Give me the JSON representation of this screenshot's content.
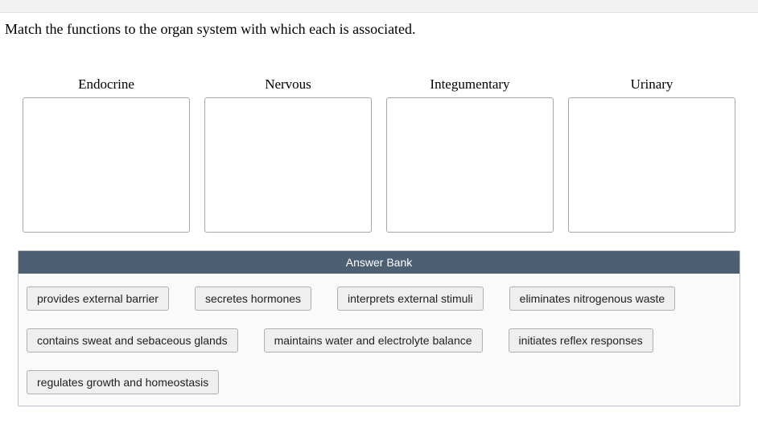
{
  "question": "Match the functions to the organ system with which each is associated.",
  "categories": [
    {
      "label": "Endocrine"
    },
    {
      "label": "Nervous"
    },
    {
      "label": "Integumentary"
    },
    {
      "label": "Urinary"
    }
  ],
  "answerBank": {
    "title": "Answer Bank",
    "rows": [
      [
        "provides external barrier",
        "secretes hormones",
        "interprets external stimuli",
        "eliminates nitrogenous waste"
      ],
      [
        "contains sweat and sebaceous glands",
        "maintains water and electrolyte balance",
        "initiates reflex responses"
      ],
      [
        "regulates growth and homeostasis"
      ]
    ]
  }
}
